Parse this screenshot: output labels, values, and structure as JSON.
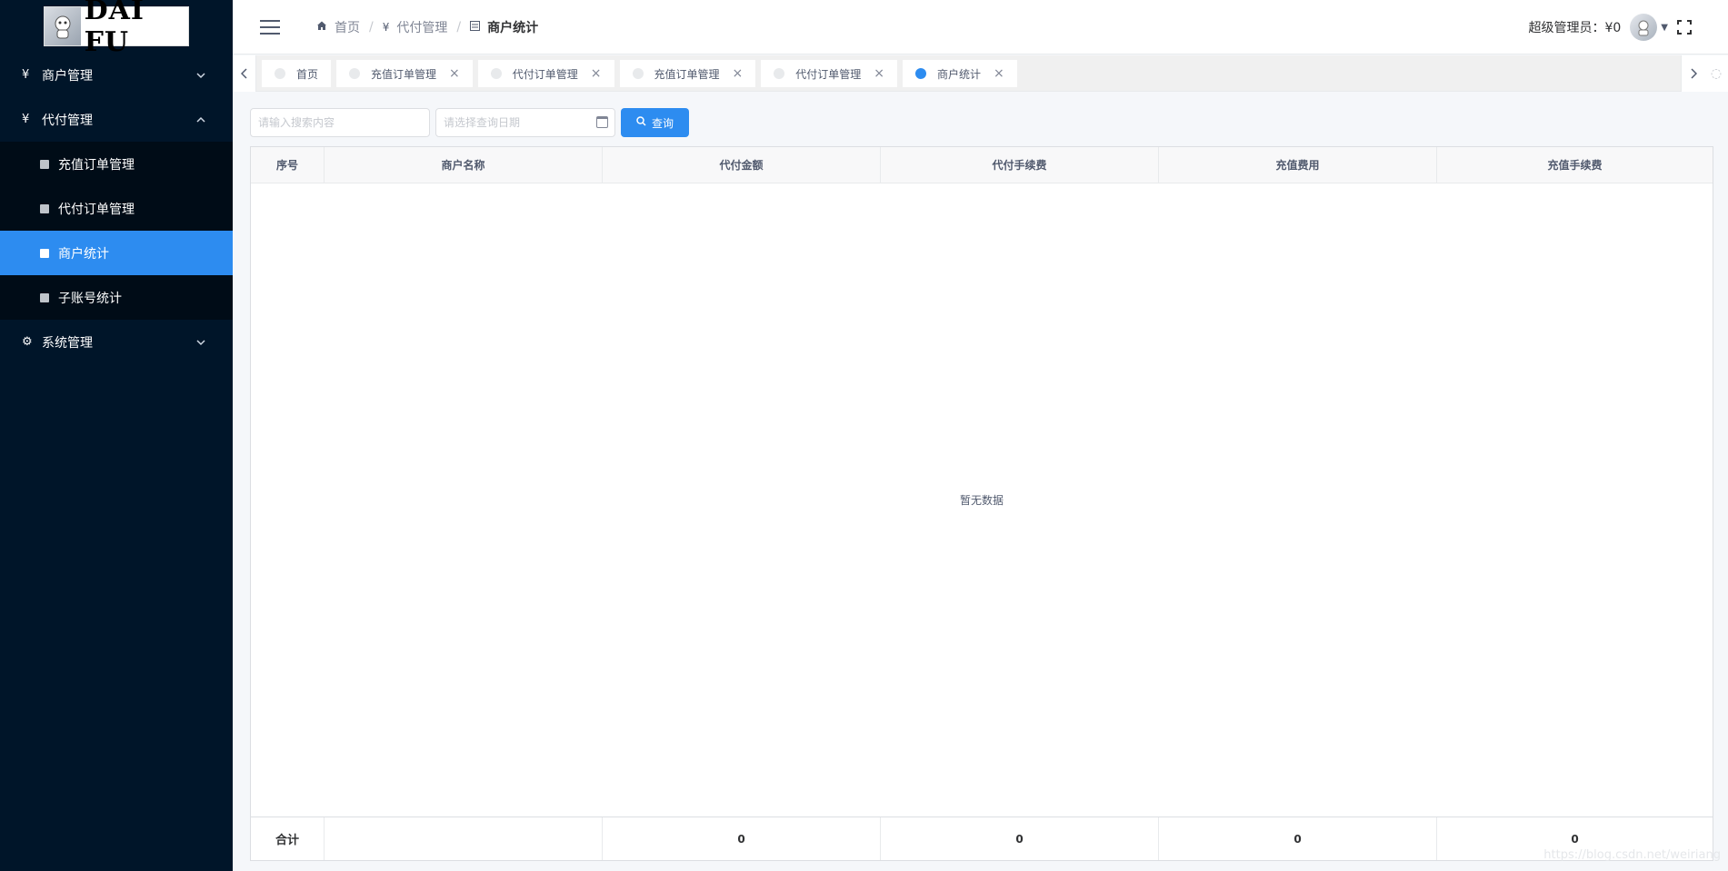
{
  "logo": {
    "text": "DAI FU"
  },
  "sidebar": {
    "items": [
      {
        "icon": "¥",
        "label": "商户管理",
        "expanded": false
      },
      {
        "icon": "¥",
        "label": "代付管理",
        "expanded": true,
        "children": [
          {
            "label": "充值订单管理",
            "active": false
          },
          {
            "label": "代付订单管理",
            "active": false
          },
          {
            "label": "商户统计",
            "active": true
          },
          {
            "label": "子账号统计",
            "active": false
          }
        ]
      },
      {
        "icon": "⚙",
        "label": "系统管理",
        "expanded": false
      }
    ]
  },
  "header": {
    "breadcrumb": [
      {
        "icon": "home-icon",
        "label": "首页"
      },
      {
        "icon": "yen-icon",
        "label": "代付管理"
      },
      {
        "icon": "list-icon",
        "label": "商户统计"
      }
    ],
    "user": "超级管理员：¥0"
  },
  "tabs": [
    {
      "label": "首页",
      "closable": false,
      "active": false
    },
    {
      "label": "充值订单管理",
      "closable": true,
      "active": false
    },
    {
      "label": "代付订单管理",
      "closable": true,
      "active": false
    },
    {
      "label": "充值订单管理",
      "closable": true,
      "active": false
    },
    {
      "label": "代付订单管理",
      "closable": true,
      "active": false
    },
    {
      "label": "商户统计",
      "closable": true,
      "active": true
    }
  ],
  "filter": {
    "search_placeholder": "请输入搜索内容",
    "date_placeholder": "请选择查询日期",
    "search_button": "查询"
  },
  "table": {
    "columns": [
      "序号",
      "商户名称",
      "代付金额",
      "代付手续费",
      "充值费用",
      "充值手续费"
    ],
    "empty_text": "暂无数据",
    "footer": [
      "合计",
      "",
      "0",
      "0",
      "0",
      "0"
    ]
  },
  "watermark": "https://blog.csdn.net/weiriang",
  "colors": {
    "sidebar_bg": "#001529",
    "submenu_bg": "#000c17",
    "accent": "#2d8cf0"
  }
}
